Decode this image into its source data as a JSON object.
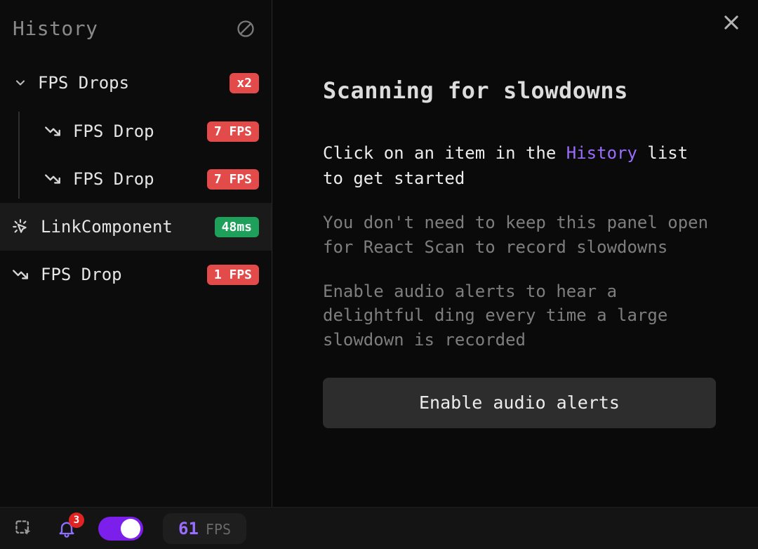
{
  "colors": {
    "accent": "#9b6dff",
    "badge_red": "#e34b4b",
    "badge_green": "#1fa05a",
    "toggle_purple": "#7c1fea"
  },
  "sidebar": {
    "title": "History",
    "group": {
      "label": "FPS Drops",
      "count_badge": "x2",
      "expanded": true,
      "items": [
        {
          "icon": "trend-down-icon",
          "label": "FPS Drop",
          "badge": "7 FPS",
          "badge_color": "red"
        },
        {
          "icon": "trend-down-icon",
          "label": "FPS Drop",
          "badge": "7 FPS",
          "badge_color": "red"
        }
      ]
    },
    "items": [
      {
        "icon": "cursor-click-icon",
        "label": "LinkComponent",
        "badge": "48ms",
        "badge_color": "green",
        "selected": true
      },
      {
        "icon": "trend-down-icon",
        "label": "FPS Drop",
        "badge": "1 FPS",
        "badge_color": "red",
        "selected": false
      }
    ]
  },
  "detail": {
    "title": "Scanning for slowdowns",
    "lead_before": "Click on an item in the ",
    "lead_highlight": "History",
    "lead_after": " list to get started",
    "para1": "You don't need to keep this panel open for React Scan to record slowdowns",
    "para2": "Enable audio alerts to hear a delightful ding every time a large slowdown is recorded",
    "audio_button": "Enable audio alerts"
  },
  "footer": {
    "notification_count": "3",
    "toggle_on": true,
    "fps_value": "61",
    "fps_label": "FPS"
  }
}
